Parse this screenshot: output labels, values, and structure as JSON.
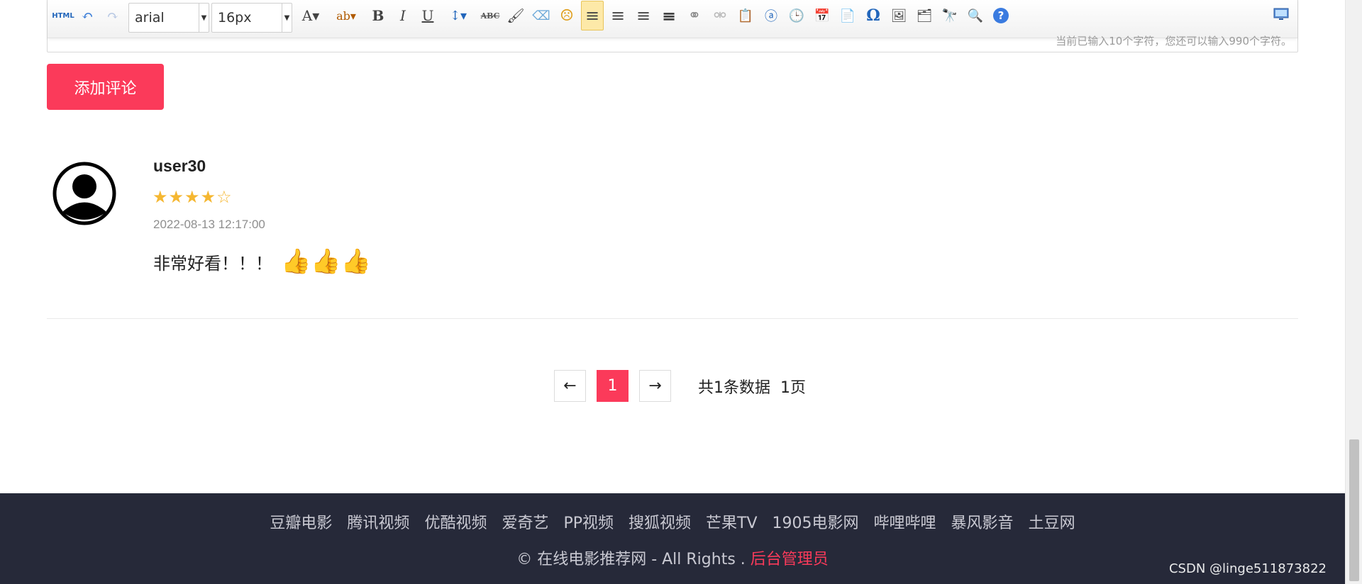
{
  "editor": {
    "font_family": "arial",
    "font_size": "16px",
    "counter_text": "当前已输入10个字符，您还可以输入990个字符。",
    "tools": [
      {
        "icon": "html-icon",
        "glyph": "HTML",
        "interactable": true
      },
      {
        "icon": "undo-icon",
        "glyph": "↶"
      },
      {
        "icon": "redo-icon",
        "glyph": "↷"
      },
      {
        "icon": "font-color-icon",
        "glyph": "A▾"
      },
      {
        "icon": "highlight-icon",
        "glyph": "ab▾"
      },
      {
        "icon": "bold-icon",
        "glyph": "B"
      },
      {
        "icon": "italic-icon",
        "glyph": "I"
      },
      {
        "icon": "underline-icon",
        "glyph": "U"
      },
      {
        "icon": "line-height-icon",
        "glyph": "↕▾"
      },
      {
        "icon": "strikethrough-icon",
        "glyph": "ABC"
      },
      {
        "icon": "format-brush-icon",
        "glyph": "🖌"
      },
      {
        "icon": "eraser-icon",
        "glyph": "⌫"
      },
      {
        "icon": "emoji-icon",
        "glyph": "☹"
      },
      {
        "icon": "align-left-icon",
        "glyph": "≡"
      },
      {
        "icon": "align-right-icon",
        "glyph": "≡"
      },
      {
        "icon": "align-center-icon",
        "glyph": "≡"
      },
      {
        "icon": "align-justify-icon",
        "glyph": "≡"
      },
      {
        "icon": "link-icon",
        "glyph": "⚭"
      },
      {
        "icon": "unlink-icon",
        "glyph": "⚮"
      },
      {
        "icon": "paste-text-icon",
        "glyph": "📋"
      },
      {
        "icon": "anchor-icon",
        "glyph": "ⓐ"
      },
      {
        "icon": "time-icon",
        "glyph": "🕒"
      },
      {
        "icon": "date-icon",
        "glyph": "📅"
      },
      {
        "icon": "page-icon",
        "glyph": "📄"
      },
      {
        "icon": "special-char-icon",
        "glyph": "Ω"
      },
      {
        "icon": "image-icon",
        "glyph": "🖼"
      },
      {
        "icon": "multi-image-icon",
        "glyph": "🗂"
      },
      {
        "icon": "find-icon",
        "glyph": "🔭"
      },
      {
        "icon": "preview-icon",
        "glyph": "🔍"
      },
      {
        "icon": "help-icon",
        "glyph": "?"
      }
    ]
  },
  "actions": {
    "add_comment": "添加评论"
  },
  "comment": {
    "user": "user30",
    "rating": 4,
    "rating_max": 5,
    "stars_text": "★★★★☆",
    "date": "2022-08-13 12:17:00",
    "text": "非常好看！！！",
    "emoji": "👍👍👍"
  },
  "pagination": {
    "prev": "←",
    "current": "1",
    "next": "→",
    "info": "共1条数据  1页"
  },
  "footer": {
    "links": [
      "豆瓣电影",
      "腾讯视频",
      "优酷视频",
      "爱奇艺",
      "PP视频",
      "搜狐视频",
      "芒果TV",
      "1905电影网",
      "哔哩哔哩",
      "暴风影音",
      "土豆网"
    ],
    "copyright_prefix": "© 在线电影推荐网 - All Rights .",
    "admin_link": "后台管理员",
    "watermark": "CSDN @linge511873822"
  },
  "colors": {
    "accent": "#fb3a5a",
    "footer_bg": "#262939",
    "star": "#f5b731",
    "toolbar_active": "#fde9a8"
  }
}
